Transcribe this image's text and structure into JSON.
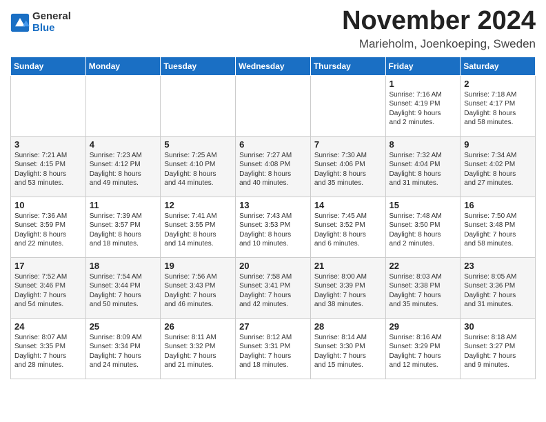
{
  "logo": {
    "general": "General",
    "blue": "Blue"
  },
  "title": "November 2024",
  "location": "Marieholm, Joenkoeping, Sweden",
  "headers": [
    "Sunday",
    "Monday",
    "Tuesday",
    "Wednesday",
    "Thursday",
    "Friday",
    "Saturday"
  ],
  "weeks": [
    [
      {
        "day": "",
        "info": ""
      },
      {
        "day": "",
        "info": ""
      },
      {
        "day": "",
        "info": ""
      },
      {
        "day": "",
        "info": ""
      },
      {
        "day": "",
        "info": ""
      },
      {
        "day": "1",
        "info": "Sunrise: 7:16 AM\nSunset: 4:19 PM\nDaylight: 9 hours\nand 2 minutes."
      },
      {
        "day": "2",
        "info": "Sunrise: 7:18 AM\nSunset: 4:17 PM\nDaylight: 8 hours\nand 58 minutes."
      }
    ],
    [
      {
        "day": "3",
        "info": "Sunrise: 7:21 AM\nSunset: 4:15 PM\nDaylight: 8 hours\nand 53 minutes."
      },
      {
        "day": "4",
        "info": "Sunrise: 7:23 AM\nSunset: 4:12 PM\nDaylight: 8 hours\nand 49 minutes."
      },
      {
        "day": "5",
        "info": "Sunrise: 7:25 AM\nSunset: 4:10 PM\nDaylight: 8 hours\nand 44 minutes."
      },
      {
        "day": "6",
        "info": "Sunrise: 7:27 AM\nSunset: 4:08 PM\nDaylight: 8 hours\nand 40 minutes."
      },
      {
        "day": "7",
        "info": "Sunrise: 7:30 AM\nSunset: 4:06 PM\nDaylight: 8 hours\nand 35 minutes."
      },
      {
        "day": "8",
        "info": "Sunrise: 7:32 AM\nSunset: 4:04 PM\nDaylight: 8 hours\nand 31 minutes."
      },
      {
        "day": "9",
        "info": "Sunrise: 7:34 AM\nSunset: 4:02 PM\nDaylight: 8 hours\nand 27 minutes."
      }
    ],
    [
      {
        "day": "10",
        "info": "Sunrise: 7:36 AM\nSunset: 3:59 PM\nDaylight: 8 hours\nand 22 minutes."
      },
      {
        "day": "11",
        "info": "Sunrise: 7:39 AM\nSunset: 3:57 PM\nDaylight: 8 hours\nand 18 minutes."
      },
      {
        "day": "12",
        "info": "Sunrise: 7:41 AM\nSunset: 3:55 PM\nDaylight: 8 hours\nand 14 minutes."
      },
      {
        "day": "13",
        "info": "Sunrise: 7:43 AM\nSunset: 3:53 PM\nDaylight: 8 hours\nand 10 minutes."
      },
      {
        "day": "14",
        "info": "Sunrise: 7:45 AM\nSunset: 3:52 PM\nDaylight: 8 hours\nand 6 minutes."
      },
      {
        "day": "15",
        "info": "Sunrise: 7:48 AM\nSunset: 3:50 PM\nDaylight: 8 hours\nand 2 minutes."
      },
      {
        "day": "16",
        "info": "Sunrise: 7:50 AM\nSunset: 3:48 PM\nDaylight: 7 hours\nand 58 minutes."
      }
    ],
    [
      {
        "day": "17",
        "info": "Sunrise: 7:52 AM\nSunset: 3:46 PM\nDaylight: 7 hours\nand 54 minutes."
      },
      {
        "day": "18",
        "info": "Sunrise: 7:54 AM\nSunset: 3:44 PM\nDaylight: 7 hours\nand 50 minutes."
      },
      {
        "day": "19",
        "info": "Sunrise: 7:56 AM\nSunset: 3:43 PM\nDaylight: 7 hours\nand 46 minutes."
      },
      {
        "day": "20",
        "info": "Sunrise: 7:58 AM\nSunset: 3:41 PM\nDaylight: 7 hours\nand 42 minutes."
      },
      {
        "day": "21",
        "info": "Sunrise: 8:00 AM\nSunset: 3:39 PM\nDaylight: 7 hours\nand 38 minutes."
      },
      {
        "day": "22",
        "info": "Sunrise: 8:03 AM\nSunset: 3:38 PM\nDaylight: 7 hours\nand 35 minutes."
      },
      {
        "day": "23",
        "info": "Sunrise: 8:05 AM\nSunset: 3:36 PM\nDaylight: 7 hours\nand 31 minutes."
      }
    ],
    [
      {
        "day": "24",
        "info": "Sunrise: 8:07 AM\nSunset: 3:35 PM\nDaylight: 7 hours\nand 28 minutes."
      },
      {
        "day": "25",
        "info": "Sunrise: 8:09 AM\nSunset: 3:34 PM\nDaylight: 7 hours\nand 24 minutes."
      },
      {
        "day": "26",
        "info": "Sunrise: 8:11 AM\nSunset: 3:32 PM\nDaylight: 7 hours\nand 21 minutes."
      },
      {
        "day": "27",
        "info": "Sunrise: 8:12 AM\nSunset: 3:31 PM\nDaylight: 7 hours\nand 18 minutes."
      },
      {
        "day": "28",
        "info": "Sunrise: 8:14 AM\nSunset: 3:30 PM\nDaylight: 7 hours\nand 15 minutes."
      },
      {
        "day": "29",
        "info": "Sunrise: 8:16 AM\nSunset: 3:29 PM\nDaylight: 7 hours\nand 12 minutes."
      },
      {
        "day": "30",
        "info": "Sunrise: 8:18 AM\nSunset: 3:27 PM\nDaylight: 7 hours\nand 9 minutes."
      }
    ]
  ]
}
